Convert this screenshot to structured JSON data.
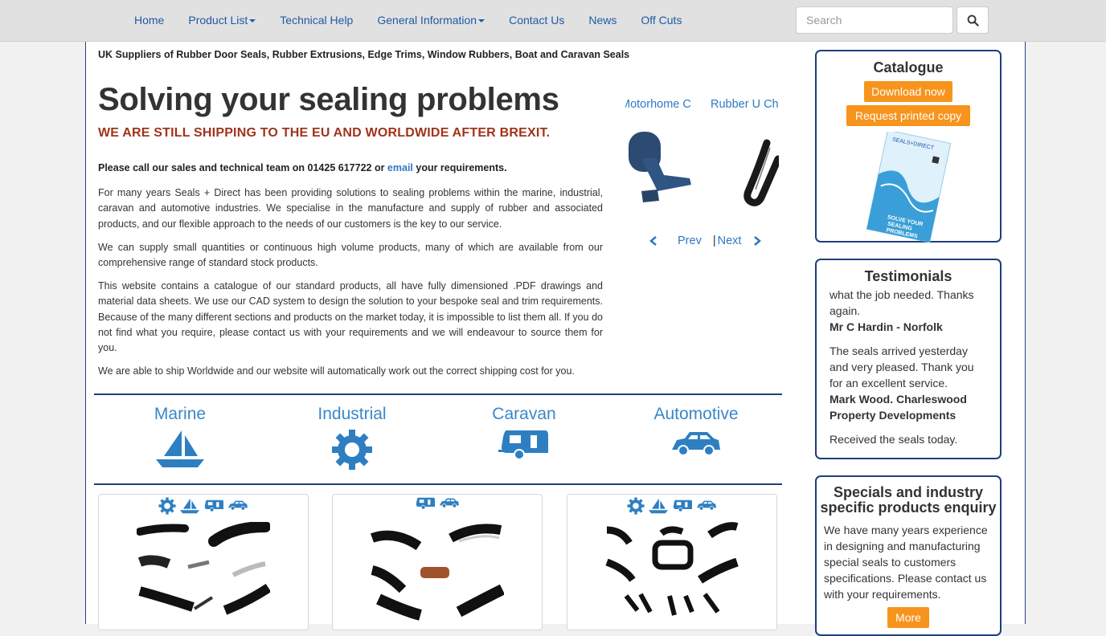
{
  "nav": {
    "items": [
      {
        "label": "Home",
        "dropdown": false
      },
      {
        "label": "Product List",
        "dropdown": true
      },
      {
        "label": "Technical Help",
        "dropdown": false
      },
      {
        "label": "General Information",
        "dropdown": true
      },
      {
        "label": "Contact Us",
        "dropdown": false
      },
      {
        "label": "News",
        "dropdown": false
      },
      {
        "label": "Off Cuts",
        "dropdown": false
      }
    ],
    "search_placeholder": "Search"
  },
  "header": {
    "tagline": "UK Suppliers of Rubber Door Seals, Rubber Extrusions, Edge Trims, Window Rubbers, Boat and Caravan Seals",
    "title": "Solving your sealing problems",
    "subtitle": "WE ARE STILL SHIPPING TO THE EU AND WORLDWIDE AFTER BREXIT."
  },
  "intro": {
    "callout_before": "Please call our sales and technical team on 01425 617722 or ",
    "callout_link": "email",
    "callout_after": " your requirements.",
    "paragraphs": [
      "For many years Seals + Direct has been providing solutions to sealing problems within the marine, industrial, caravan and automotive industries. We specialise in the manufacture and supply of rubber and associated products, and our flexible approach to the needs of our customers is the key to our service.",
      "We can supply small quantities or continuous high volume products, many of which are available from our comprehensive range of standard stock products.",
      "This website contains a catalogue of our standard products, all have fully dimensioned .PDF drawings and material data sheets. We use our CAD system to design the solution to your bespoke seal and trim requirements. Because of the many different sections and products on the market today, it is impossible to list them all. If you do not find what you require, please contact us with your requirements and we will endeavour to source them for you.",
      "We are able to ship Worldwide and our website will automatically work out the correct shipping cost for you."
    ]
  },
  "carousel": {
    "items": [
      "Motorhome C",
      "Rubber U Ch"
    ],
    "prev": "Prev",
    "separator": "|",
    "next": "Next"
  },
  "categories": [
    {
      "label": "Marine",
      "icon": "sailboat-icon"
    },
    {
      "label": "Industrial",
      "icon": "gear-icon"
    },
    {
      "label": "Caravan",
      "icon": "caravan-icon"
    },
    {
      "label": "Automotive",
      "icon": "car-icon"
    }
  ],
  "sidebar": {
    "catalogue": {
      "title": "Catalogue",
      "download": "Download now",
      "request": "Request printed copy",
      "cover_text": "SOLVE YOUR SEALING PROBLEMS",
      "cover_brand": "SEALS+DIRECT"
    },
    "testimonials": {
      "title": "Testimonials",
      "items": [
        {
          "text": "what the job needed. Thanks again.",
          "author": "Mr C Hardin - Norfolk"
        },
        {
          "text": "The seals arrived yesterday and very pleased. Thank you for an excellent service.",
          "author": "Mark Wood. Charleswood Property Developments"
        },
        {
          "text": "Received the seals today.",
          "author": ""
        }
      ]
    },
    "specials": {
      "title": "Specials and industry specific products enquiry",
      "text": "We have many years experience in designing and manufacturing special seals to customers specifications. Please contact us with your requirements.",
      "button": "More"
    }
  },
  "colors": {
    "nav_link": "#1f5aa6",
    "accent_blue": "#3a87c8",
    "border_navy": "#1f3e7e",
    "brexit_red": "#a0331a",
    "button_orange": "#f7941d"
  }
}
